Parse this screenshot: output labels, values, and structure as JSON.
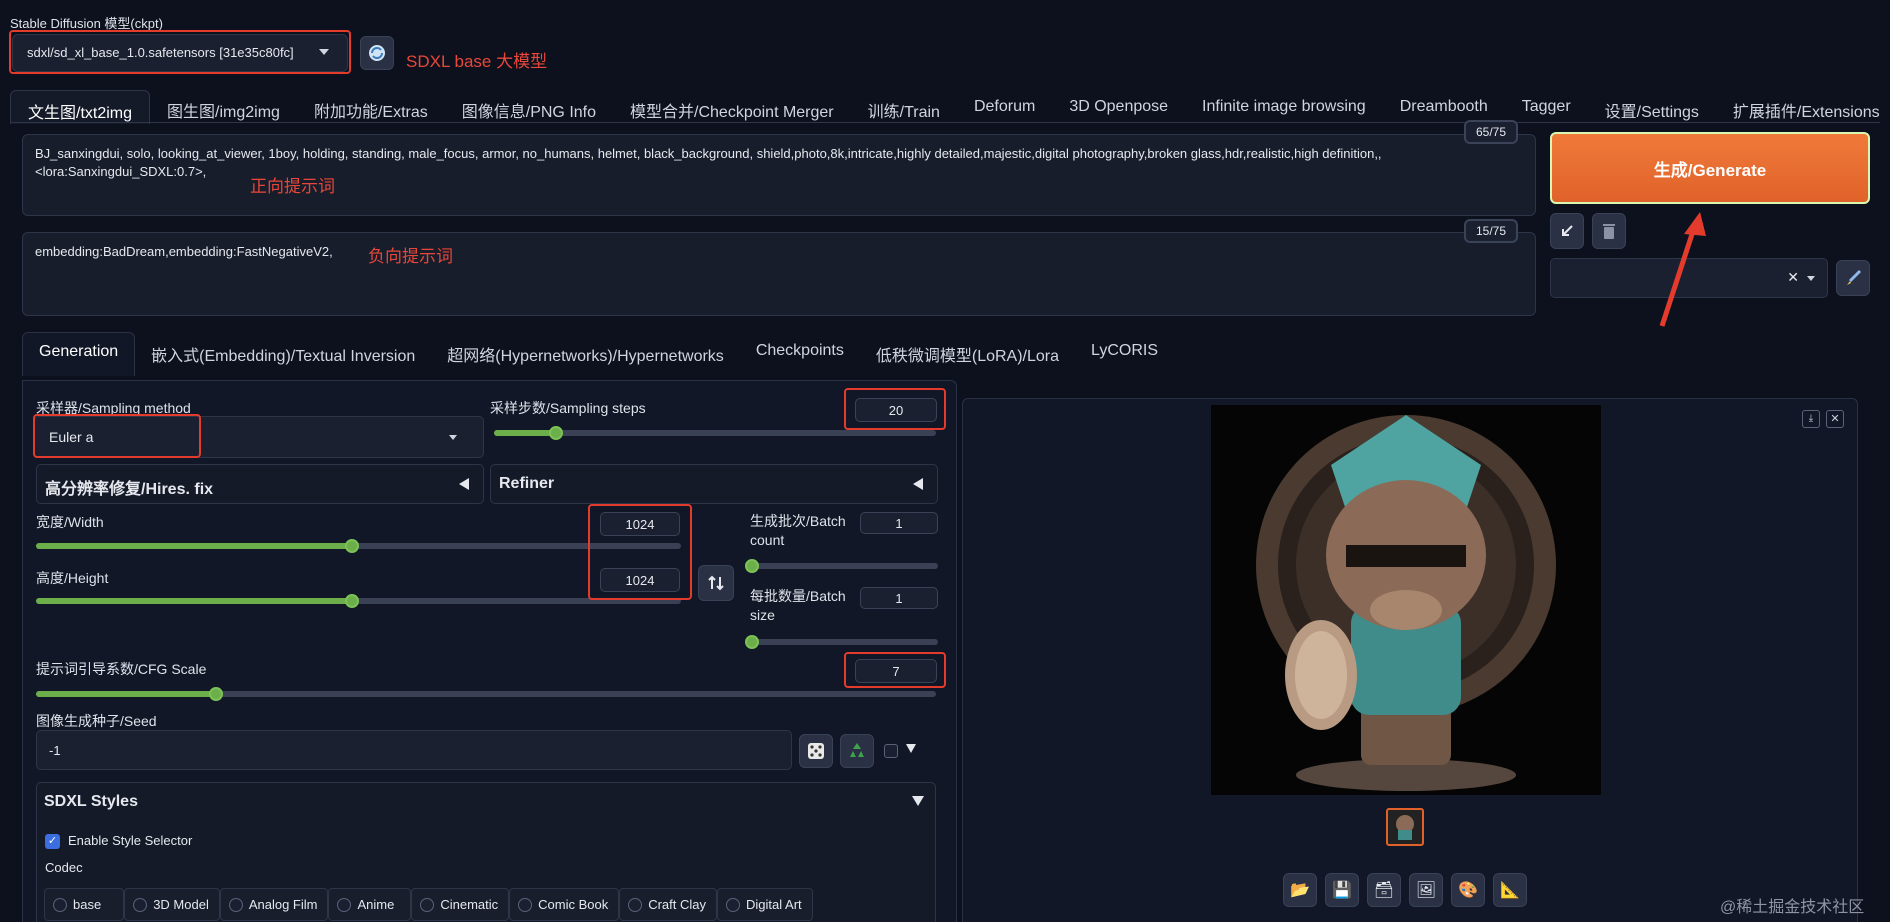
{
  "model": {
    "label": "Stable Diffusion 模型(ckpt)",
    "selected": "sdxl/sd_xl_base_1.0.safetensors [31e35c80fc]",
    "note": "SDXL base 大模型"
  },
  "tabs": [
    "文生图/txt2img",
    "图生图/img2img",
    "附加功能/Extras",
    "图像信息/PNG Info",
    "模型合并/Checkpoint Merger",
    "训练/Train",
    "Deforum",
    "3D Openpose",
    "Infinite image browsing",
    "Dreambooth",
    "Tagger",
    "设置/Settings",
    "扩展插件/Extensions"
  ],
  "prompt": {
    "text_line1": "BJ_sanxingdui, solo, looking_at_viewer, 1boy, holding, standing, male_focus, armor, no_humans, helmet, black_background, shield,photo,8k,intricate,highly detailed,majestic,digital photography,broken glass,hdr,realistic,high definition,,",
    "text_line2": "<lora:Sanxingdui_SDXL:0.7>,",
    "tokens": "65/75",
    "note": "正向提示词"
  },
  "negative": {
    "text": "embedding:BadDream,embedding:FastNegativeV2,",
    "tokens": "15/75",
    "note": "负向提示词"
  },
  "generate_label": "生成/Generate",
  "subtabs": [
    "Generation",
    "嵌入式(Embedding)/Textual Inversion",
    "超网络(Hypernetworks)/Hypernetworks",
    "Checkpoints",
    "低秩微调模型(LoRA)/Lora",
    "LyCORIS"
  ],
  "sampler": {
    "label": "采样器/Sampling method",
    "value": "Euler a"
  },
  "steps": {
    "label": "采样步数/Sampling steps",
    "value": "20",
    "fraction": 0.14
  },
  "hires_label": "高分辨率修复/Hires. fix",
  "refiner_label": "Refiner",
  "width": {
    "label": "宽度/Width",
    "value": "1024",
    "fraction": 0.49
  },
  "height": {
    "label": "高度/Height",
    "value": "1024",
    "fraction": 0.49
  },
  "batch_count": {
    "label": "生成批次/Batch count",
    "value": "1",
    "fraction": 0
  },
  "batch_size": {
    "label": "每批数量/Batch size",
    "value": "1",
    "fraction": 0
  },
  "cfg": {
    "label": "提示词引导系数/CFG Scale",
    "value": "7",
    "fraction": 0.2
  },
  "seed": {
    "label": "图像生成种子/Seed",
    "value": "-1"
  },
  "sdxl": {
    "title": "SDXL Styles",
    "enable_label": "Enable Style Selector",
    "codec_label": "Codec",
    "styles": [
      "base",
      "3D Model",
      "Analog Film",
      "Anime",
      "Cinematic",
      "Comic Book",
      "Craft Clay",
      "Digital Art"
    ]
  },
  "watermark": "@稀土掘金技术社区",
  "colors": {
    "accent": "#e0622a",
    "slider": "#6cae4a",
    "annotation": "#e53b2c"
  }
}
